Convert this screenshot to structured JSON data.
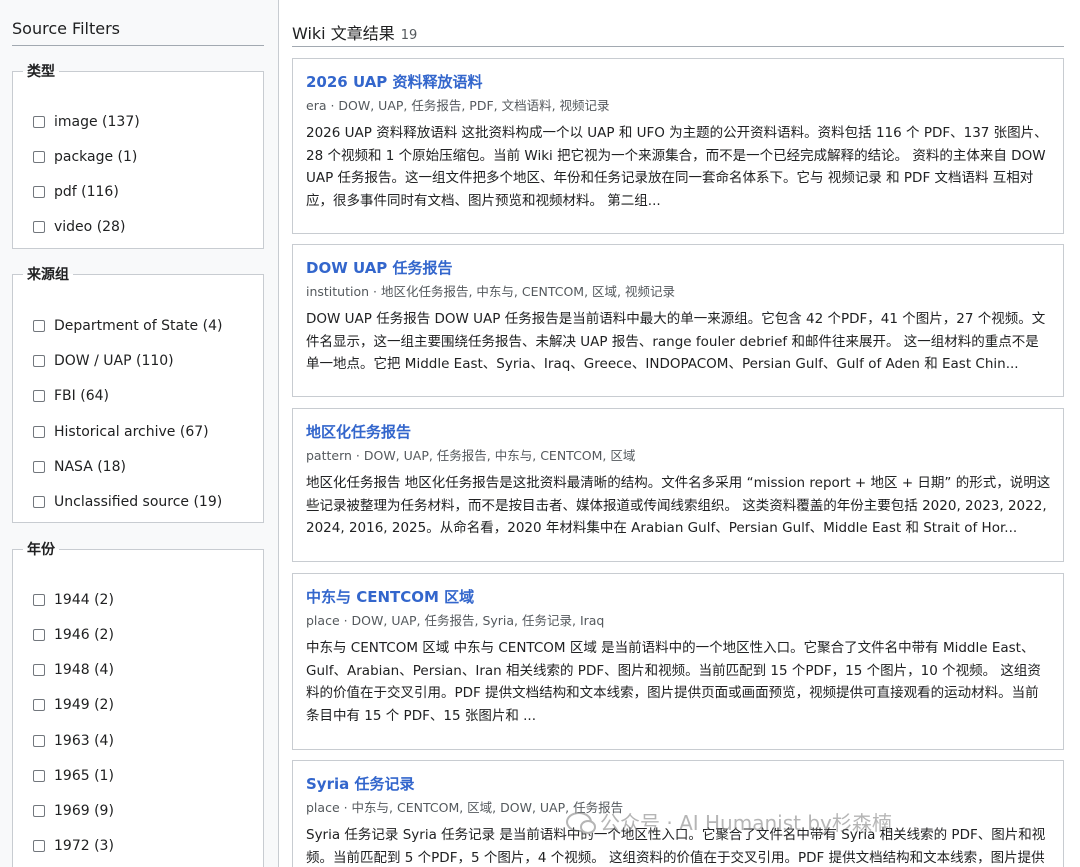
{
  "sidebar": {
    "title": "Source Filters",
    "groups": [
      {
        "label": "类型",
        "options": [
          "image (137)",
          "package (1)",
          "pdf (116)",
          "video (28)"
        ]
      },
      {
        "label": "来源组",
        "options": [
          "Department of State (4)",
          "DOW / UAP (110)",
          "FBI (64)",
          "Historical archive (67)",
          "NASA (18)",
          "Unclassified source (19)"
        ]
      },
      {
        "label": "年份",
        "options": [
          "1944 (2)",
          "1946 (2)",
          "1948 (4)",
          "1949 (2)",
          "1963 (4)",
          "1965 (1)",
          "1969 (9)",
          "1972 (3)"
        ]
      }
    ]
  },
  "results": {
    "title": "Wiki 文章结果",
    "count": "19",
    "items": [
      {
        "title": "2026 UAP 资料释放语料",
        "meta": "era · DOW, UAP, 任务报告, PDF, 文档语料, 视频记录",
        "snippet": "2026 UAP 资料释放语料 这批资料构成一个以 UAP 和 UFO 为主题的公开资料语料。资料包括 116 个 PDF、137 张图片、28 个视频和 1 个原始压缩包。当前 Wiki 把它视为一个来源集合，而不是一个已经完成解释的结论。 资料的主体来自 DOW UAP 任务报告。这一组文件把多个地区、年份和任务记录放在同一套命名体系下。它与 视频记录 和 PDF 文档语料 互相对应，很多事件同时有文档、图片预览和视频材料。 第二组..."
      },
      {
        "title": "DOW UAP 任务报告",
        "meta": "institution · 地区化任务报告, 中东与, CENTCOM, 区域, 视频记录",
        "snippet": "DOW UAP 任务报告 DOW UAP 任务报告是当前语料中最大的单一来源组。它包含 42 个PDF，41 个图片，27 个视频。文件名显示，这一组主要围绕任务报告、未解决 UAP 报告、range fouler debrief 和邮件往来展开。 这一组材料的重点不是单一地点。它把 Middle East、Syria、Iraq、Greece、INDOPACOM、Persian Gulf、Gulf of Aden 和 East Chin..."
      },
      {
        "title": "地区化任务报告",
        "meta": "pattern · DOW, UAP, 任务报告, 中东与, CENTCOM, 区域",
        "snippet": "地区化任务报告 地区化任务报告是这批资料最清晰的结构。文件名多采用 “mission report + 地区 + 日期” 的形式，说明这些记录被整理为任务材料，而不是按目击者、媒体报道或传闻线索组织。 这类资料覆盖的年份主要包括 2020, 2023, 2022, 2024, 2016, 2025。从命名看，2020 年材料集中在 Arabian Gulf、Persian Gulf、Middle East 和 Strait of Hor..."
      },
      {
        "title": "中东与 CENTCOM 区域",
        "meta": "place · DOW, UAP, 任务报告, Syria, 任务记录, Iraq",
        "snippet": "中东与 CENTCOM 区域 中东与 CENTCOM 区域 是当前语料中的一个地区性入口。它聚合了文件名中带有 Middle East、Gulf、Arabian、Persian、Iran 相关线索的 PDF、图片和视频。当前匹配到 15 个PDF，15 个图片，10 个视频。 这组资料的价值在于交叉引用。PDF 提供文档结构和文本线索，图片提供页面或画面预览，视频提供可直接观看的运动材料。当前条目中有 15 个 PDF、15 张图片和 ..."
      },
      {
        "title": "Syria 任务记录",
        "meta": "place · 中东与, CENTCOM, 区域, DOW, UAP, 任务报告",
        "snippet": "Syria 任务记录 Syria 任务记录 是当前语料中的一个地区性入口。它聚合了文件名中带有 Syria 相关线索的 PDF、图片和视频。当前匹配到 5 个PDF，5 个图片，4 个视频。 这组资料的价值在于交叉引用。PDF 提供文档结构和文本线索，图片提供页面或画面预览，视频提供可直接观看的运动材料。"
      }
    ]
  },
  "watermark": {
    "icon": "wechat-icon",
    "text": "公众号 · AI Humanist by杉森楠"
  }
}
